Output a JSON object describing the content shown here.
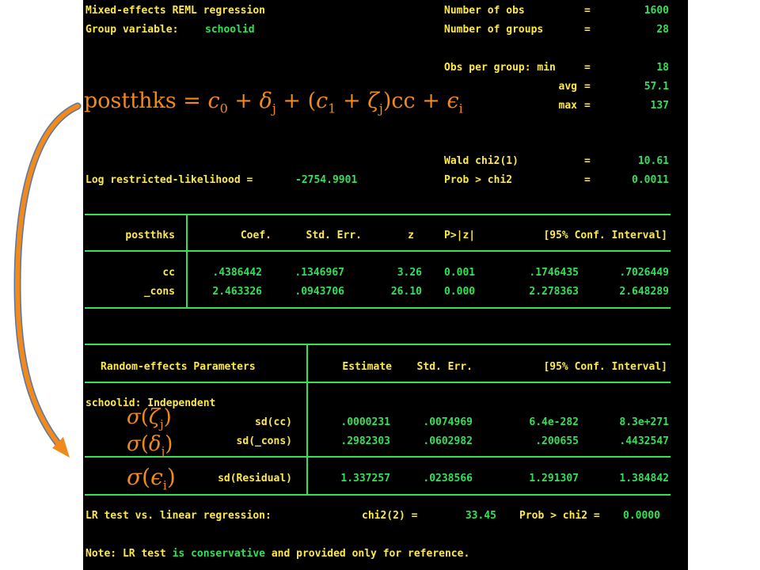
{
  "header": {
    "title": "Mixed-effects REML regression",
    "group_label": "Group variable:",
    "group_var": "schoolid",
    "loglik_label": "Log restricted-likelihood =",
    "loglik_value": "-2754.9901",
    "stats": [
      {
        "label": "Number of obs",
        "eq": "=",
        "value": "1600"
      },
      {
        "label": "Number of groups",
        "eq": "=",
        "value": "28"
      },
      {
        "label": "Obs per group: min",
        "eq": "=",
        "value": "18"
      },
      {
        "label": "avg",
        "eq": "=",
        "value": "57.1"
      },
      {
        "label": "max",
        "eq": "=",
        "value": "137"
      },
      {
        "label": "Wald chi2(1)",
        "eq": "=",
        "value": "10.61"
      },
      {
        "label": "Prob > chi2",
        "eq": "=",
        "value": "0.0011"
      }
    ]
  },
  "fixed_table": {
    "depvar": "postthks",
    "columns": [
      "Coef.",
      "Std. Err.",
      "z",
      "P>|z|",
      "[95% Conf. Interval]"
    ],
    "rows": [
      {
        "name": "cc",
        "coef": ".4386442",
        "se": ".1346967",
        "z": "3.26",
        "p": "0.001",
        "lo": ".1746435",
        "hi": ".7026449"
      },
      {
        "name": "_cons",
        "coef": "2.463326",
        "se": ".0943706",
        "z": "26.10",
        "p": "0.000",
        "lo": "2.278363",
        "hi": "2.648289"
      }
    ]
  },
  "random_table": {
    "header": "Random-effects Parameters",
    "columns": [
      "Estimate",
      "Std. Err.",
      "[95% Conf. Interval]"
    ],
    "group_label": "schoolid: Independent",
    "rows": [
      {
        "name": "sd(cc)",
        "est": ".0000231",
        "se": ".0074969",
        "lo": "6.4e-282",
        "hi": "8.3e+271"
      },
      {
        "name": "sd(_cons)",
        "est": ".2982303",
        "se": ".0602982",
        "lo": ".200655",
        "hi": ".4432547"
      },
      {
        "name": "sd(Residual)",
        "est": "1.337257",
        "se": ".0238566",
        "lo": "1.291307",
        "hi": "1.384842"
      }
    ]
  },
  "lr_test": {
    "label": "LR test vs. linear regression:",
    "chi_label": "chi2(2) =",
    "chi_value": "33.45",
    "prob_label": "Prob > chi2 =",
    "prob_value": "0.0000"
  },
  "note": {
    "prefix": "Note:",
    "a": " LR test ",
    "b": "is conservative",
    "c": " and provided only for reference."
  },
  "annotations": {
    "equation": {
      "lhs": "postthks",
      "eq": " = ",
      "c0": "c",
      "c0_sub": "0",
      "plus1": " + ",
      "delta": "δ",
      "delta_sub": "j",
      "plus2": " + (",
      "c1": "c",
      "c1_sub": "1",
      "plus3": " + ",
      "zeta": "ζ",
      "zeta_sub": "j",
      "close": ")cc + ",
      "eps": "ϵ",
      "eps_sub": "i"
    },
    "sigma_zeta": {
      "sigma": "σ",
      "open": "(",
      "sym": "ζ",
      "sub": "j",
      "close": ")"
    },
    "sigma_delta": {
      "sigma": "σ",
      "open": "(",
      "sym": "δ",
      "sub": "j",
      "close": ")"
    },
    "sigma_eps": {
      "sigma": "σ",
      "open": "(",
      "sym": "ϵ",
      "sub": "i",
      "close": ")"
    },
    "arrow_color": "#f08a1c",
    "arrow_outline": "#5577aa"
  },
  "colors": {
    "background": "#000000",
    "label": "#fde94a",
    "value": "#33e05a",
    "text": "#ffffff"
  }
}
